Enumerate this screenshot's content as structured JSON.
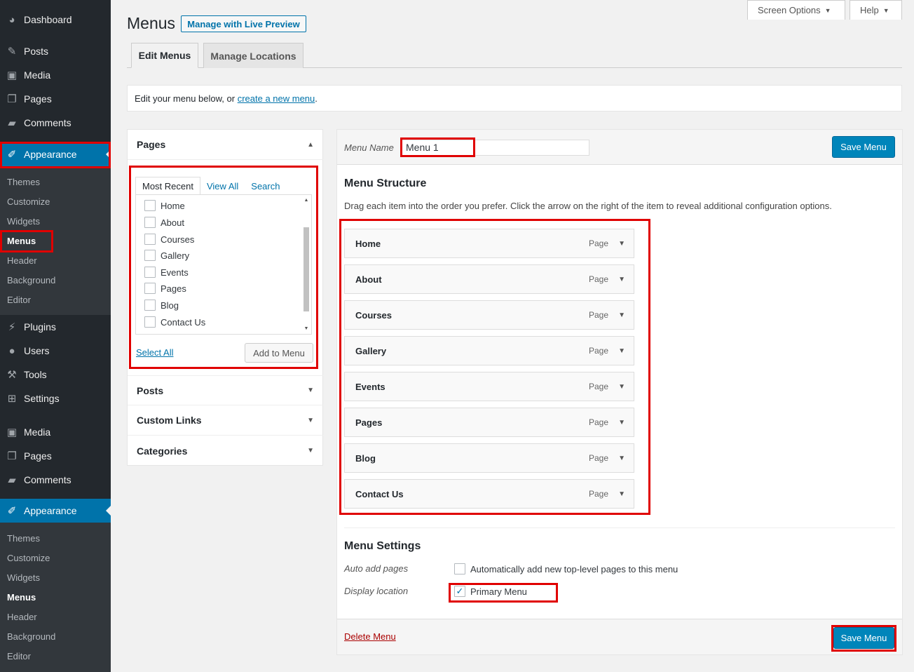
{
  "sidebar": {
    "top_items": [
      {
        "label": "Dashboard",
        "icon": "dashboard-icon"
      },
      {
        "label": "Posts",
        "icon": "pin-icon"
      },
      {
        "label": "Media",
        "icon": "media-icon"
      },
      {
        "label": "Pages",
        "icon": "pages-icon"
      },
      {
        "label": "Comments",
        "icon": "comments-icon"
      }
    ],
    "appearance": "Appearance",
    "submenu": [
      "Themes",
      "Customize",
      "Widgets",
      "Menus",
      "Header",
      "Background",
      "Editor"
    ],
    "mid_items": [
      {
        "label": "Plugins",
        "icon": "plugins-icon"
      },
      {
        "label": "Users",
        "icon": "users-icon"
      },
      {
        "label": "Tools",
        "icon": "tools-icon"
      },
      {
        "label": "Settings",
        "icon": "settings-icon"
      }
    ],
    "lower_items": [
      {
        "label": "Media",
        "icon": "media-icon"
      },
      {
        "label": "Pages",
        "icon": "pages-icon"
      },
      {
        "label": "Comments",
        "icon": "comments-icon"
      }
    ],
    "appearance2": "Appearance",
    "submenu2": [
      "Themes",
      "Customize",
      "Widgets",
      "Menus",
      "Header",
      "Background",
      "Editor"
    ]
  },
  "header": {
    "title": "Menus",
    "live_preview": "Manage with Live Preview",
    "screen_options": "Screen Options",
    "help": "Help"
  },
  "tabs": [
    "Edit Menus",
    "Manage Locations"
  ],
  "notice": {
    "prefix": "Edit your menu below, or ",
    "link": "create a new menu",
    "suffix": "."
  },
  "left_panel": {
    "pages_title": "Pages",
    "subtabs": [
      "Most Recent",
      "View All",
      "Search"
    ],
    "pages": [
      "Home",
      "About",
      "Courses",
      "Gallery",
      "Events",
      "Pages",
      "Blog",
      "Contact Us"
    ],
    "select_all": "Select All",
    "add_to_menu": "Add to Menu",
    "sections": [
      "Posts",
      "Custom Links",
      "Categories"
    ]
  },
  "menu": {
    "name_label": "Menu Name",
    "name_value": "Menu 1",
    "save": "Save Menu",
    "structure_title": "Menu Structure",
    "structure_desc": "Drag each item into the order you prefer. Click the arrow on the right of the item to reveal additional configuration options.",
    "items": [
      {
        "title": "Home",
        "type": "Page"
      },
      {
        "title": "About",
        "type": "Page"
      },
      {
        "title": "Courses",
        "type": "Page"
      },
      {
        "title": "Gallery",
        "type": "Page"
      },
      {
        "title": "Events",
        "type": "Page"
      },
      {
        "title": "Pages",
        "type": "Page"
      },
      {
        "title": "Blog",
        "type": "Page"
      },
      {
        "title": "Contact Us",
        "type": "Page"
      }
    ],
    "settings_title": "Menu Settings",
    "auto_add_label": "Auto add pages",
    "auto_add_text": "Automatically add new top-level pages to this menu",
    "display_location_label": "Display location",
    "primary_menu": "Primary Menu",
    "primary_checked": true,
    "delete": "Delete Menu"
  },
  "colors": {
    "accent": "#0073aa",
    "highlight": "#e00000",
    "sidebar": "#23282d",
    "primary_button": "#0085ba"
  }
}
